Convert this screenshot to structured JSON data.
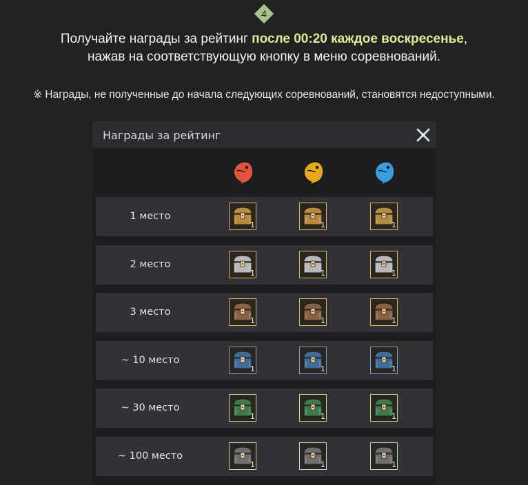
{
  "step": {
    "number": "4"
  },
  "headline": {
    "part1": "Получайте награды за рейтинг ",
    "highlight": "после 00:20 каждое воскресенье",
    "part2": ",",
    "line2": "нажав на соответствующую кнопку в меню соревнований."
  },
  "note": "※ Награды, не полученные до начала следующих соревнований, становятся недоступными.",
  "panel": {
    "title": "Награды за рейтинг",
    "columns": [
      {
        "icon": "red-fish-icon",
        "color": "#e0533c"
      },
      {
        "icon": "gold-fish-icon",
        "color": "#e8a81e"
      },
      {
        "icon": "blue-fish-icon",
        "color": "#3a9de0"
      }
    ],
    "rows": [
      {
        "label": "1 место",
        "chest": "gold-chest-icon",
        "qty": "1",
        "frame": "#d8b35a",
        "tint": "#b88a3c"
      },
      {
        "label": "2 место",
        "chest": "silver-chest-icon",
        "qty": "1",
        "frame": "#d8b35a",
        "tint": "#b8b8b8"
      },
      {
        "label": "3 место",
        "chest": "bronze-chest-icon",
        "qty": "1",
        "frame": "#d8b35a",
        "tint": "#8a6242"
      },
      {
        "label": "~ 10 место",
        "chest": "blue-chest-icon",
        "qty": "1",
        "frame": "#7d9fc4",
        "tint": "#3f6d9a"
      },
      {
        "label": "~ 30 место",
        "chest": "green-chest-icon",
        "qty": "1",
        "frame": "#cbd38a",
        "tint": "#3f7a4c"
      },
      {
        "label": "~ 100 место",
        "chest": "gray-chest-icon",
        "qty": "1",
        "frame": "#c8c8c8",
        "tint": "#6e6e6e"
      }
    ]
  }
}
